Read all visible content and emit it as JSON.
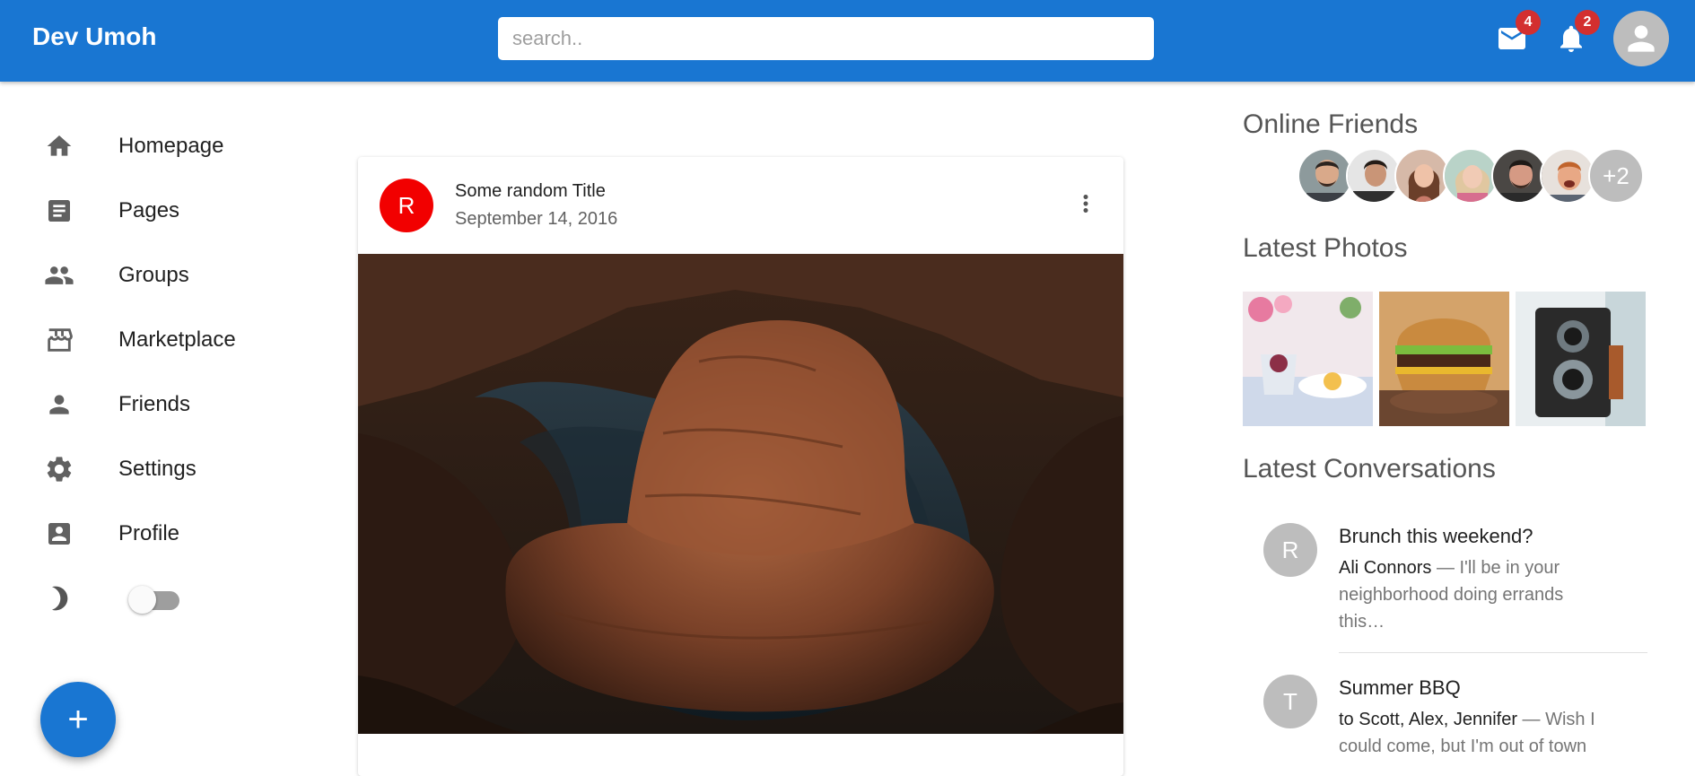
{
  "header": {
    "brand": "Dev Umoh",
    "search_placeholder": "search..",
    "mail_badge": "4",
    "notification_badge": "2"
  },
  "sidebar": {
    "items": [
      {
        "label": "Homepage",
        "icon": "home-icon"
      },
      {
        "label": "Pages",
        "icon": "article-icon"
      },
      {
        "label": "Groups",
        "icon": "group-icon"
      },
      {
        "label": "Marketplace",
        "icon": "storefront-icon"
      },
      {
        "label": "Friends",
        "icon": "person-icon"
      },
      {
        "label": "Settings",
        "icon": "gear-icon"
      },
      {
        "label": "Profile",
        "icon": "account-box-icon"
      }
    ],
    "dark_mode_enabled": false,
    "fab_label": "+"
  },
  "post": {
    "avatar_letter": "R",
    "title": "Some random Title",
    "date": "September 14, 2016",
    "avatar_color": "#f20000"
  },
  "right": {
    "online_friends_heading": "Online Friends",
    "online_friends_more": "+2",
    "latest_photos_heading": "Latest Photos",
    "latest_conversations_heading": "Latest Conversations",
    "conversations": [
      {
        "avatar_letter": "R",
        "title": "Brunch this weekend?",
        "sender": "Ali Connors",
        "snippet": " — I'll be in your neighborhood doing errands this…"
      },
      {
        "avatar_letter": "T",
        "title": "Summer BBQ",
        "sender": "to Scott, Alex, Jennifer",
        "snippet": " — Wish I could come, but I'm out of town"
      }
    ]
  },
  "colors": {
    "primary": "#1976d2",
    "badge": "#d32f2f"
  }
}
